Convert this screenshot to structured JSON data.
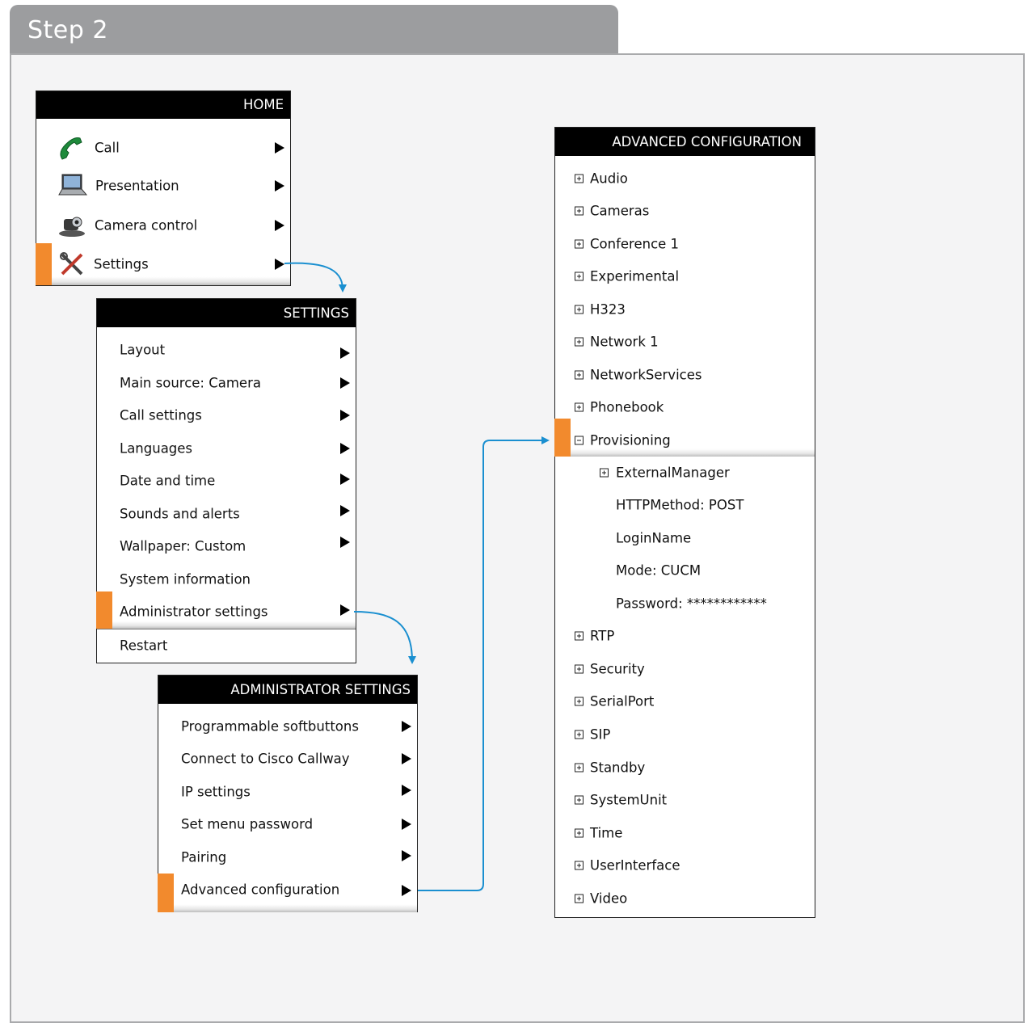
{
  "step": {
    "title": "Step 2"
  },
  "home": {
    "header": "HOME",
    "items": [
      {
        "label": "Call",
        "icon": "phone-icon"
      },
      {
        "label": "Presentation",
        "icon": "laptop-icon"
      },
      {
        "label": "Camera control",
        "icon": "camera-icon"
      },
      {
        "label": "Settings",
        "icon": "tools-icon"
      }
    ]
  },
  "settings": {
    "header": "SETTINGS",
    "items": [
      "Layout",
      "Main source: Camera",
      "Call settings",
      "Languages",
      "Date and time",
      "Sounds and alerts",
      "Wallpaper: Custom",
      "System information",
      "Administrator settings",
      "Restart"
    ]
  },
  "admin": {
    "header": "ADMINISTRATOR SETTINGS",
    "items": [
      "Programmable softbuttons",
      "Connect to Cisco Callway",
      "IP settings",
      "Set menu password",
      "Pairing",
      "Advanced configuration"
    ]
  },
  "advanced": {
    "header": "ADVANCED CONFIGURATION",
    "items": [
      "Audio",
      "Cameras",
      "Conference 1",
      "Experimental",
      "H323",
      "Network 1",
      "NetworkServices",
      "Phonebook",
      "Provisioning"
    ],
    "provisioning_children": [
      "ExternalManager",
      "HTTPMethod: POST",
      "LoginName",
      "Mode: CUCM",
      "Password: ************"
    ],
    "items_after": [
      "RTP",
      "Security",
      "SerialPort",
      "SIP",
      "Standby",
      "SystemUnit",
      "Time",
      "UserInterface",
      "Video"
    ]
  },
  "colors": {
    "accent_orange": "#f28a2d",
    "connector_blue": "#1a8fd0",
    "frame_gray": "#9c9d9f"
  }
}
